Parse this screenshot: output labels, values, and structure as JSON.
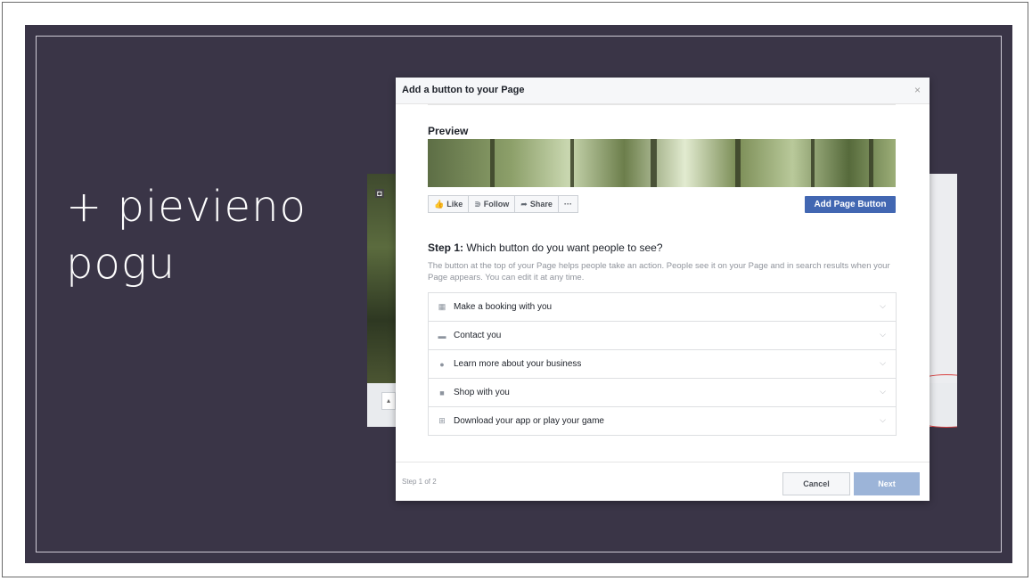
{
  "slide": {
    "title": "+ pievieno pogu"
  },
  "dialog": {
    "title": "Add a button to your Page",
    "close": "×",
    "preview_label": "Preview",
    "page_actions": [
      {
        "icon": "👍",
        "label": "Like"
      },
      {
        "icon": "⋑",
        "label": "Follow"
      },
      {
        "icon": "➦",
        "label": "Share"
      },
      {
        "icon": "",
        "label": "···"
      }
    ],
    "add_page_button": "Add Page Button",
    "step_label": "Step 1:",
    "step_question": " Which button do you want people to see?",
    "step_description": "The button at the top of your Page helps people take an action. People see it on your Page and in search results when your Page appears. You can edit it at any time.",
    "options": [
      {
        "icon": "▦",
        "label": "Make a booking with you"
      },
      {
        "icon": "▬",
        "label": "Contact you"
      },
      {
        "icon": "●",
        "label": "Learn more about your business"
      },
      {
        "icon": "■",
        "label": "Shop with you"
      },
      {
        "icon": "⊞",
        "label": "Download your app or play your game"
      }
    ],
    "chevron": "⌵",
    "step_count": "Step 1 of 2",
    "cancel": "Cancel",
    "next": "Next"
  },
  "colors": {
    "slide_bg": "#3a3547",
    "fb_blue": "#4267b2",
    "next_disabled": "#9cb4d8",
    "annotation_red": "#d84040"
  }
}
